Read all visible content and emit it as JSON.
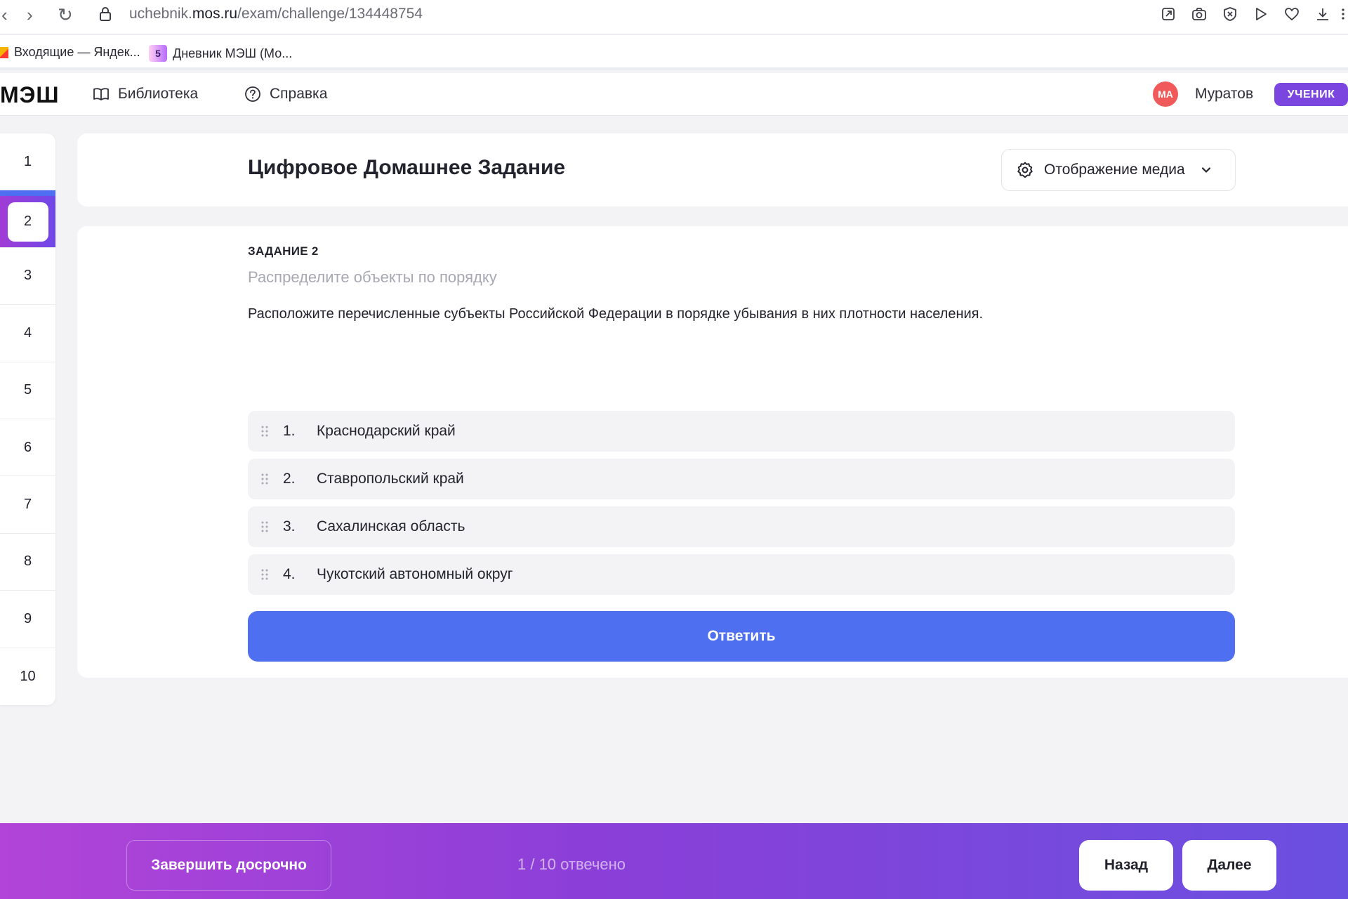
{
  "browser": {
    "url_prefix": "uchebnik.",
    "url_host": "mos.ru",
    "url_path": "/exam/challenge/134448754",
    "nav_back": "‹",
    "nav_forward": "›",
    "nav_reload": "↻"
  },
  "bookmarks": [
    {
      "label": "Входящие — Яндек..."
    },
    {
      "icon_text": "5",
      "label": "Дневник МЭШ (Мо..."
    }
  ],
  "header": {
    "logo": "МЭШ",
    "nav": [
      {
        "label": "Библиотека",
        "icon": "book-icon"
      },
      {
        "label": "Справка",
        "icon": "help-circle-icon"
      }
    ],
    "avatar_initials": "МА",
    "user_name": "Муратов",
    "role": "УЧЕНИК"
  },
  "questions": {
    "items": [
      "1",
      "2",
      "3",
      "4",
      "5",
      "6",
      "7",
      "8",
      "9",
      "10"
    ],
    "active": "2"
  },
  "title_card": {
    "title": "Цифровое Домашнее Задание",
    "media_button": "Отображение медиа"
  },
  "task": {
    "label": "ЗАДАНИЕ 2",
    "type": "Распределите объекты по порядку",
    "text": "Расположите перечисленные субъекты Российской Федерации в порядке убывания в них плотности населения.",
    "items": [
      {
        "num": "1.",
        "label": "Краснодарский край"
      },
      {
        "num": "2.",
        "label": "Ставропольский край"
      },
      {
        "num": "3.",
        "label": "Сахалинская область"
      },
      {
        "num": "4.",
        "label": "Чукотский автономный округ"
      }
    ],
    "answer_button": "Ответить"
  },
  "footer": {
    "finish_button": "Завершить досрочно",
    "progress": "1 / 10 отвечено",
    "back_button": "Назад",
    "next_button": "Далее"
  },
  "colors": {
    "primary": "#4d6ff0",
    "role_badge": "#7b45e0",
    "avatar": "#f05a5a",
    "bottom_gradient_start": "#b244d8",
    "bottom_gradient_end": "#6a50e0"
  }
}
